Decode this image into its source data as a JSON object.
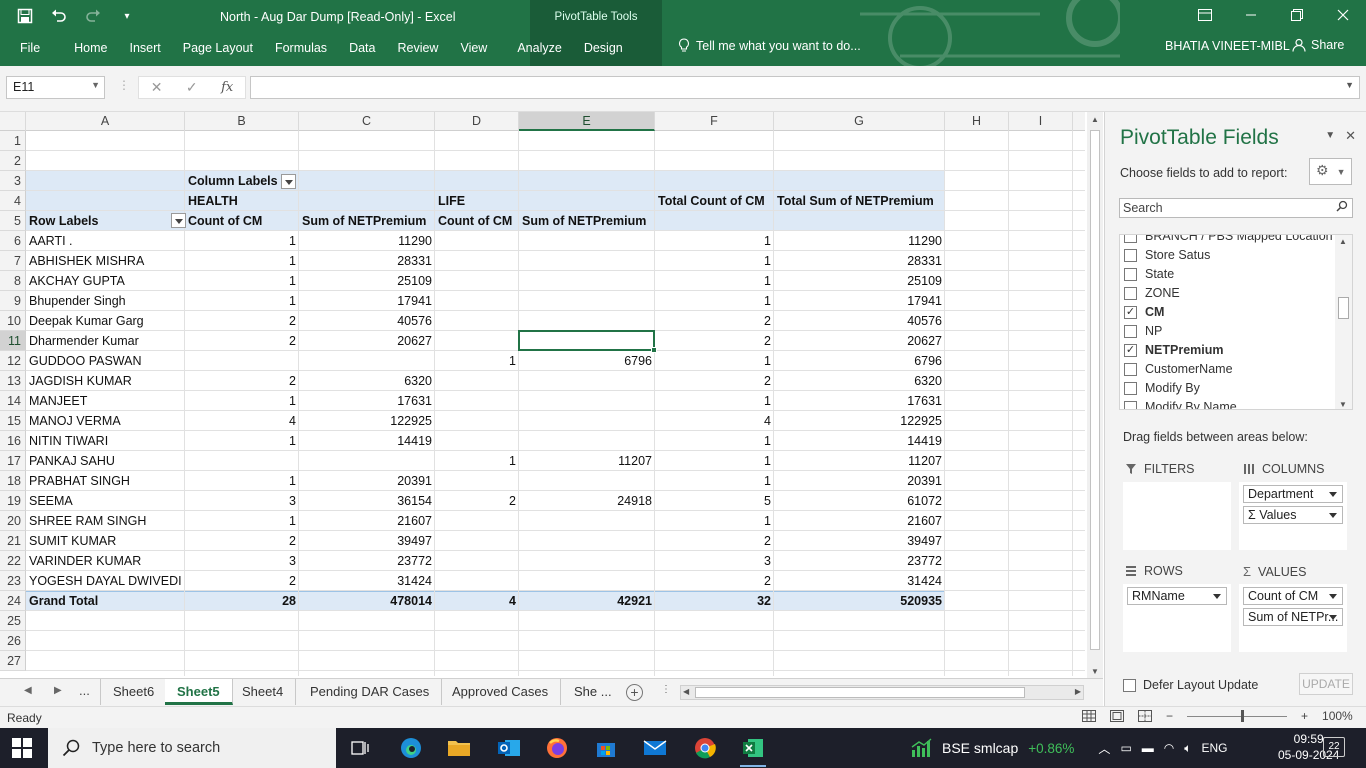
{
  "window": {
    "doc_title": "North - Aug Dar Dump  [Read-Only] - Excel",
    "contextual_tools": "PivotTable Tools",
    "user": "BHATIA VINEET-MIBL",
    "share": "Share",
    "tell_me": "Tell me what you want to do..."
  },
  "ribbon_tabs": [
    "File",
    "Home",
    "Insert",
    "Page Layout",
    "Formulas",
    "Data",
    "Review",
    "View",
    "Analyze",
    "Design"
  ],
  "formula_bar": {
    "name_box": "E11",
    "fx": "fx",
    "formula": ""
  },
  "columns": [
    "A",
    "B",
    "C",
    "D",
    "E",
    "F",
    "G",
    "H",
    "I"
  ],
  "rows": [
    "1",
    "2",
    "3",
    "4",
    "5",
    "6",
    "7",
    "8",
    "9",
    "10",
    "11",
    "12",
    "13",
    "14",
    "15",
    "16",
    "17",
    "18",
    "19",
    "20",
    "21",
    "22",
    "23",
    "24",
    "25",
    "26",
    "27"
  ],
  "selected": {
    "column": "E",
    "row": "11"
  },
  "pivot": {
    "column_labels": "Column Labels",
    "health": "HEALTH",
    "life": "LIFE",
    "row_labels": "Row Labels",
    "count_cm": "Count of CM",
    "sum_np": "Sum of NETPremium",
    "total_count": "Total Count of CM",
    "total_sum": "Total Sum of NETPremium",
    "data": [
      {
        "name": "AARTI .",
        "hc": "1",
        "hs": "11290",
        "lc": "",
        "ls": "",
        "tc": "1",
        "ts": "11290"
      },
      {
        "name": "ABHISHEK MISHRA",
        "hc": "1",
        "hs": "28331",
        "lc": "",
        "ls": "",
        "tc": "1",
        "ts": "28331"
      },
      {
        "name": "AKCHAY GUPTA",
        "hc": "1",
        "hs": "25109",
        "lc": "",
        "ls": "",
        "tc": "1",
        "ts": "25109"
      },
      {
        "name": "Bhupender Singh",
        "hc": "1",
        "hs": "17941",
        "lc": "",
        "ls": "",
        "tc": "1",
        "ts": "17941"
      },
      {
        "name": "Deepak Kumar Garg",
        "hc": "2",
        "hs": "40576",
        "lc": "",
        "ls": "",
        "tc": "2",
        "ts": "40576"
      },
      {
        "name": "Dharmender Kumar",
        "hc": "2",
        "hs": "20627",
        "lc": "",
        "ls": "",
        "tc": "2",
        "ts": "20627"
      },
      {
        "name": "GUDDOO PASWAN",
        "hc": "",
        "hs": "",
        "lc": "1",
        "ls": "6796",
        "tc": "1",
        "ts": "6796"
      },
      {
        "name": "JAGDISH KUMAR",
        "hc": "2",
        "hs": "6320",
        "lc": "",
        "ls": "",
        "tc": "2",
        "ts": "6320"
      },
      {
        "name": "MANJEET",
        "hc": "1",
        "hs": "17631",
        "lc": "",
        "ls": "",
        "tc": "1",
        "ts": "17631"
      },
      {
        "name": "MANOJ VERMA",
        "hc": "4",
        "hs": "122925",
        "lc": "",
        "ls": "",
        "tc": "4",
        "ts": "122925"
      },
      {
        "name": "NITIN TIWARI",
        "hc": "1",
        "hs": "14419",
        "lc": "",
        "ls": "",
        "tc": "1",
        "ts": "14419"
      },
      {
        "name": "PANKAJ SAHU",
        "hc": "",
        "hs": "",
        "lc": "1",
        "ls": "11207",
        "tc": "1",
        "ts": "11207"
      },
      {
        "name": "PRABHAT SINGH",
        "hc": "1",
        "hs": "20391",
        "lc": "",
        "ls": "",
        "tc": "1",
        "ts": "20391"
      },
      {
        "name": "SEEMA",
        "hc": "3",
        "hs": "36154",
        "lc": "2",
        "ls": "24918",
        "tc": "5",
        "ts": "61072"
      },
      {
        "name": "SHREE RAM SINGH",
        "hc": "1",
        "hs": "21607",
        "lc": "",
        "ls": "",
        "tc": "1",
        "ts": "21607"
      },
      {
        "name": "SUMIT KUMAR",
        "hc": "2",
        "hs": "39497",
        "lc": "",
        "ls": "",
        "tc": "2",
        "ts": "39497"
      },
      {
        "name": "VARINDER KUMAR",
        "hc": "3",
        "hs": "23772",
        "lc": "",
        "ls": "",
        "tc": "3",
        "ts": "23772"
      },
      {
        "name": "YOGESH DAYAL DWIVEDI",
        "hc": "2",
        "hs": "31424",
        "lc": "",
        "ls": "",
        "tc": "2",
        "ts": "31424"
      }
    ],
    "grand_total": {
      "name": "Grand Total",
      "hc": "28",
      "hs": "478014",
      "lc": "4",
      "ls": "42921",
      "tc": "32",
      "ts": "520935"
    }
  },
  "sheet_tabs": {
    "ellipsis": "...",
    "tabs": [
      "Sheet6",
      "Sheet5",
      "Sheet4",
      "Pending DAR Cases",
      "Approved Cases",
      "She ..."
    ],
    "active": "Sheet5"
  },
  "status": {
    "ready": "Ready",
    "zoom": "100%"
  },
  "pivot_panel": {
    "title": "PivotTable Fields",
    "choose": "Choose fields to add to report:",
    "search_placeholder": "Search",
    "fields": [
      {
        "label": "BRANCH / PBS Mapped Location",
        "checked": false
      },
      {
        "label": "Store Satus",
        "checked": false
      },
      {
        "label": "State",
        "checked": false
      },
      {
        "label": "ZONE",
        "checked": false
      },
      {
        "label": "CM",
        "checked": true
      },
      {
        "label": "NP",
        "checked": false
      },
      {
        "label": "NETPremium",
        "checked": true
      },
      {
        "label": "CustomerName",
        "checked": false
      },
      {
        "label": "Modify By",
        "checked": false
      },
      {
        "label": "Modify By Name",
        "checked": false
      }
    ],
    "drag_text": "Drag fields between areas below:",
    "filters": "FILTERS",
    "columns": "COLUMNS",
    "rows": "ROWS",
    "values": "VALUES",
    "columns_items": [
      "Department",
      "Σ Values"
    ],
    "rows_items": [
      "RMName"
    ],
    "values_items": [
      "Count of CM",
      "Sum of NETPr..."
    ],
    "defer": "Defer Layout Update",
    "update": "UPDATE"
  },
  "taskbar": {
    "search": "Type here to search",
    "ticker": "BSE smlcap",
    "ticker_change": "+0.86%",
    "lang": "ENG",
    "time": "09:59",
    "date": "05-09-2024",
    "notifications": "22"
  },
  "colors": {
    "excel_green": "#217346",
    "pivot_band": "#dde9f6",
    "positive": "#3fbf5a"
  }
}
